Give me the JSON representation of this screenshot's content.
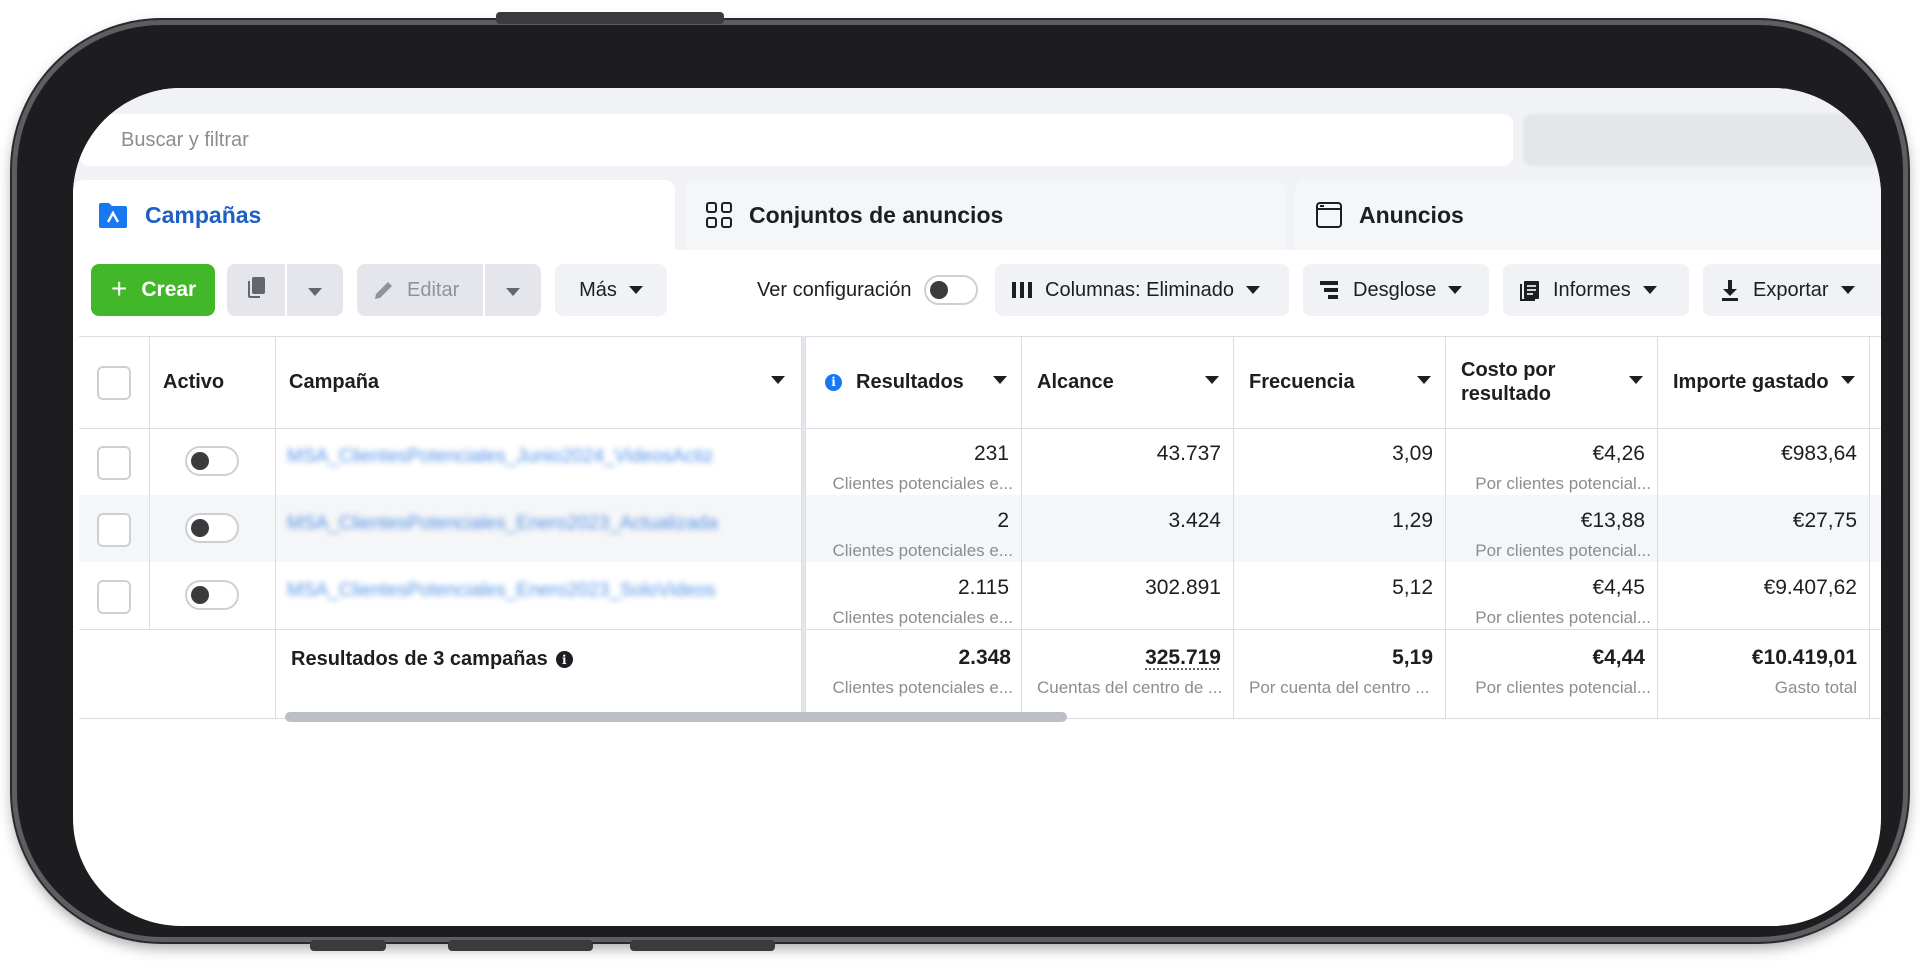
{
  "search": {
    "placeholder": "Buscar y filtrar"
  },
  "tabs": [
    {
      "label": "Campañas",
      "icon": "folder-icon",
      "active": true
    },
    {
      "label": "Conjuntos de anuncios",
      "icon": "grid-icon",
      "active": false
    },
    {
      "label": "Anuncios",
      "icon": "window-icon",
      "active": false
    }
  ],
  "toolbar": {
    "create_label": "Crear",
    "edit_label": "Editar",
    "more_label": "Más",
    "view_config_label": "Ver configuración",
    "columns_label": "Columnas: Eliminado",
    "breakdown_label": "Desglose",
    "reports_label": "Informes",
    "export_label": "Exportar"
  },
  "table": {
    "headers": {
      "active": "Activo",
      "campaign": "Campaña",
      "results": "Resultados",
      "reach": "Alcance",
      "frequency": "Frecuencia",
      "cost_per_result_line1": "Costo por",
      "cost_per_result_line2": "resultado",
      "amount_spent": "Importe gastado"
    },
    "rows": [
      {
        "campaign": "MSA_ClientesPotenciales_Junio2024_VideosActiz",
        "results": "231",
        "results_sub": "Clientes potenciales e...",
        "reach": "43.737",
        "frequency": "3,09",
        "cost": "€4,26",
        "cost_sub": "Por clientes potencial...",
        "spent": "€983,64"
      },
      {
        "campaign": "MSA_ClientesPotenciales_Enero2023_Actualizada",
        "results": "2",
        "results_sub": "Clientes potenciales e...",
        "reach": "3.424",
        "frequency": "1,29",
        "cost": "€13,88",
        "cost_sub": "Por clientes potencial...",
        "spent": "€27,75"
      },
      {
        "campaign": "MSA_ClientesPotenciales_Enero2023_SoloVideos",
        "results": "2.115",
        "results_sub": "Clientes potenciales e...",
        "reach": "302.891",
        "frequency": "5,12",
        "cost": "€4,45",
        "cost_sub": "Por clientes potencial...",
        "spent": "€9.407,62"
      }
    ],
    "totals": {
      "label": "Resultados de 3 campañas",
      "results": "2.348",
      "results_sub": "Clientes potenciales e...",
      "reach": "325.719",
      "reach_sub": "Cuentas del centro de ...",
      "frequency": "5,19",
      "frequency_sub": "Por cuenta del centro ...",
      "cost": "€4,44",
      "cost_sub": "Por clientes potencial...",
      "spent": "€10.419,01",
      "spent_sub": "Gasto total"
    }
  },
  "colors": {
    "accent": "#1d5fc4",
    "create_green": "#42b72a",
    "info_blue": "#1877f2"
  }
}
